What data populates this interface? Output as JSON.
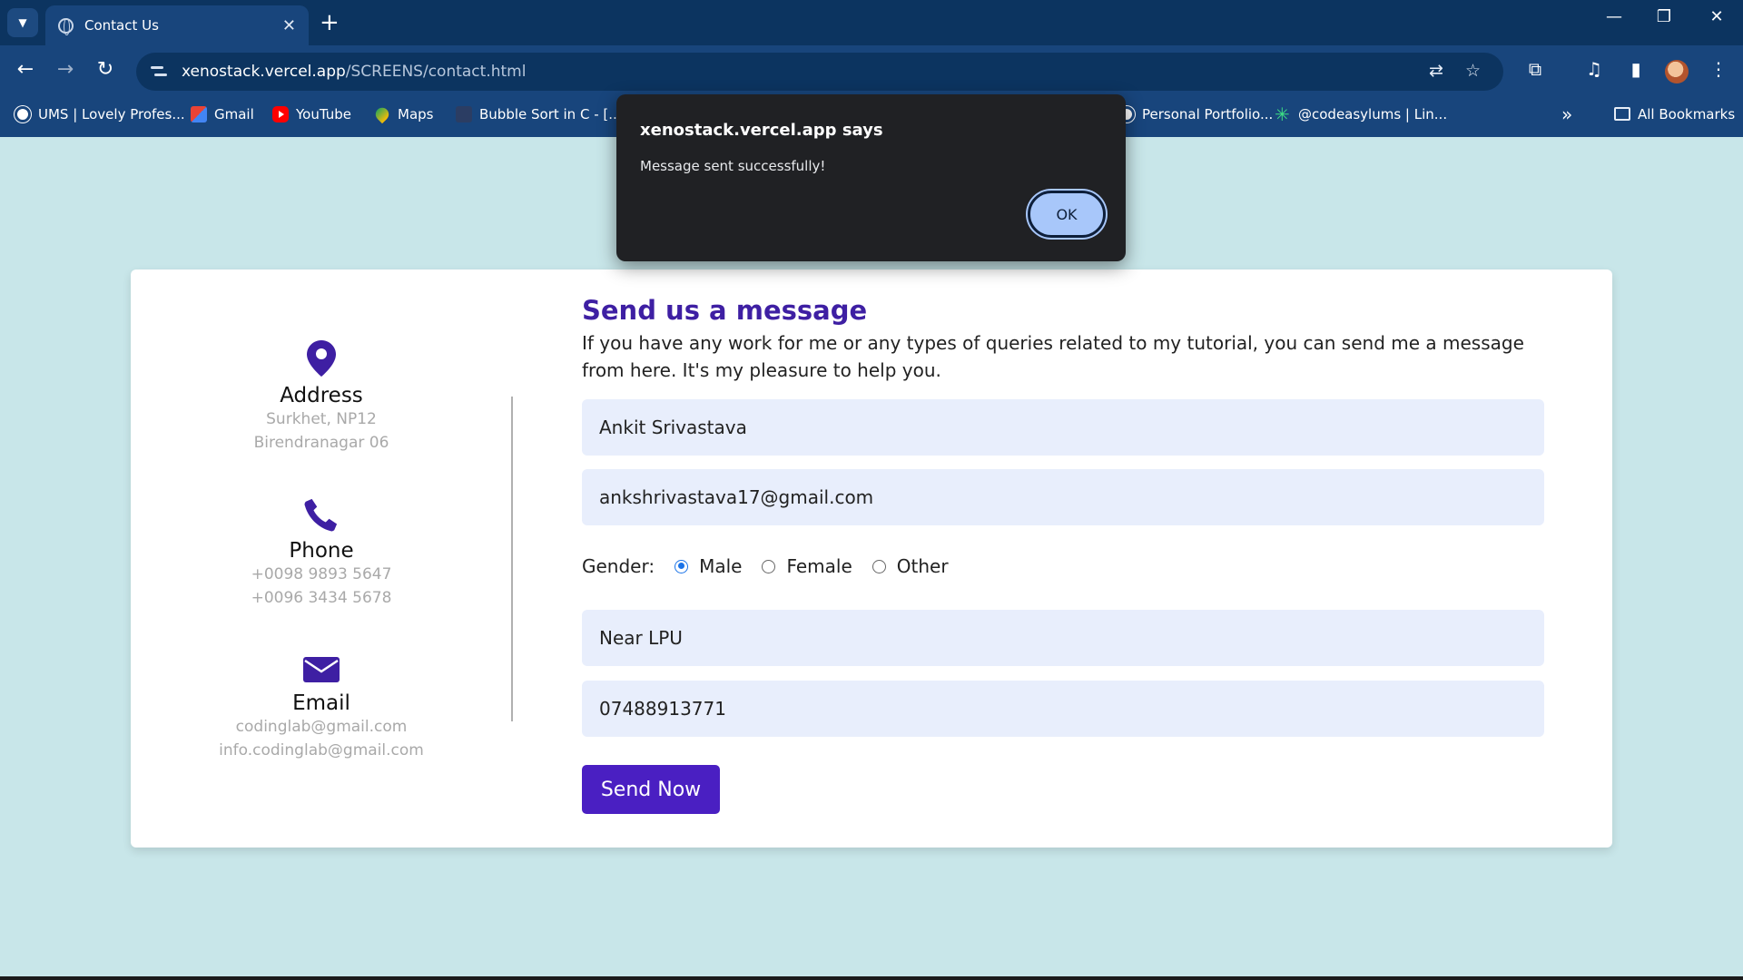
{
  "browser": {
    "tab_title": "Contact Us",
    "tab_close": "✕",
    "new_tab": "+",
    "url_host": "xenostack.vercel.app",
    "url_path": "/SCREENS/contact.html",
    "window_controls": [
      "—",
      "❐",
      "✕"
    ],
    "bookmarks": [
      {
        "label": "UMS | Lovely Profes...",
        "icon": "globe-icon"
      },
      {
        "label": "Gmail",
        "icon": "gmail-icon"
      },
      {
        "label": "YouTube",
        "icon": "youtube-icon"
      },
      {
        "label": "Maps",
        "icon": "maps-icon"
      },
      {
        "label": "Bubble Sort in C - [...",
        "icon": "code-icon"
      },
      {
        "label": "Personal Portfolio...",
        "icon": "globe-icon"
      },
      {
        "label": "@codeasylums | Lin...",
        "icon": "star-icon"
      }
    ],
    "more_bookmarks": "»",
    "all_bookmarks": "All Bookmarks"
  },
  "dialog": {
    "title": "xenostack.vercel.app says",
    "message": "Message sent successfully!",
    "ok_label": "OK"
  },
  "contact_info": {
    "address": {
      "title": "Address",
      "lines": [
        "Surkhet, NP12",
        "Birendranagar 06"
      ]
    },
    "phone": {
      "title": "Phone",
      "lines": [
        "+0098 9893 5647",
        "+0096 3434 5678"
      ]
    },
    "email": {
      "title": "Email",
      "lines": [
        "codinglab@gmail.com",
        "info.codinglab@gmail.com"
      ]
    }
  },
  "form": {
    "title": "Send us a message",
    "description": "If you have any work for me or any types of queries related to my tutorial, you can send me a message from here. It's my pleasure to help you.",
    "name_value": "Ankit Srivastava",
    "email_value": "ankshrivastava17@gmail.com",
    "gender_label": "Gender:",
    "gender_options": [
      "Male",
      "Female",
      "Other"
    ],
    "gender_selected": "Male",
    "address_value": "Near LPU",
    "phone_value": "07488913771",
    "submit_label": "Send Now"
  },
  "colors": {
    "page_bg": "#c8e6e9",
    "accent": "#4a1fc2",
    "heading": "#3e1fa3",
    "field_bg": "#e8eefc",
    "chrome": "#18457c"
  }
}
